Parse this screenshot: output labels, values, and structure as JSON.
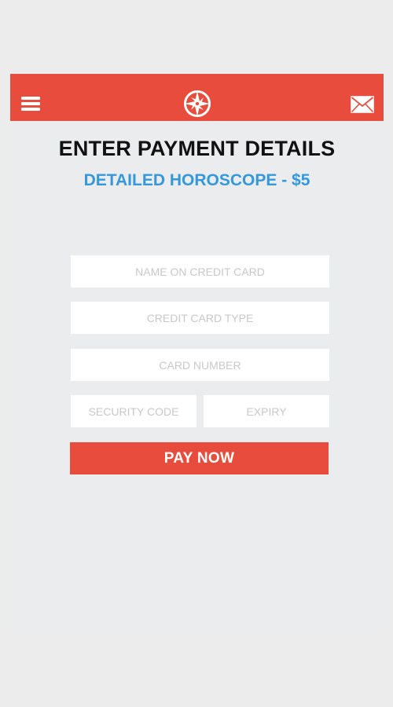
{
  "header": {
    "menu_icon": "hamburger-menu-icon",
    "logo_icon": "compass-logo-icon",
    "mail_icon": "envelope-icon"
  },
  "page": {
    "title": "ENTER PAYMENT DETAILS",
    "subtitle": "DETAILED HOROSCOPE - $5"
  },
  "form": {
    "name_placeholder": "NAME ON CREDIT CARD",
    "card_type_placeholder": "CREDIT CARD TYPE",
    "card_number_placeholder": "CARD NUMBER",
    "security_code_placeholder": "SECURITY CODE",
    "expiry_placeholder": "EXPIRY",
    "pay_label": "PAY NOW"
  },
  "colors": {
    "brand_red": "#e74c3c",
    "accent_blue": "#3498db",
    "title_text": "#111111",
    "background": "#ebeced"
  }
}
